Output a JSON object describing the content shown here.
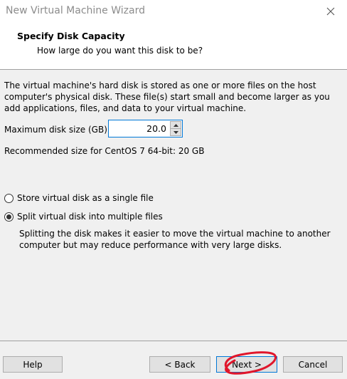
{
  "window": {
    "title": "New Virtual Machine Wizard"
  },
  "header": {
    "title": "Specify Disk Capacity",
    "subtitle": "How large do you want this disk to be?"
  },
  "content": {
    "description": "The virtual machine's hard disk is stored as one or more files on the host computer's physical disk. These file(s) start small and become larger as you add applications, files, and data to your virtual machine.",
    "disk_size_label": "Maximum disk size (GB):",
    "disk_size_value": "20.0",
    "recommended": "Recommended size for CentOS 7 64-bit: 20 GB",
    "options": [
      {
        "label": "Store virtual disk as a single file",
        "checked": false
      },
      {
        "label": "Split virtual disk into multiple files",
        "checked": true
      }
    ],
    "split_description": "Splitting the disk makes it easier to move the virtual machine to another computer but may reduce performance with very large disks."
  },
  "footer": {
    "help": "Help",
    "back": "< Back",
    "next": "Next >",
    "cancel": "Cancel"
  },
  "colors": {
    "focus_border": "#0078d7",
    "annotation": "#e0162b"
  }
}
